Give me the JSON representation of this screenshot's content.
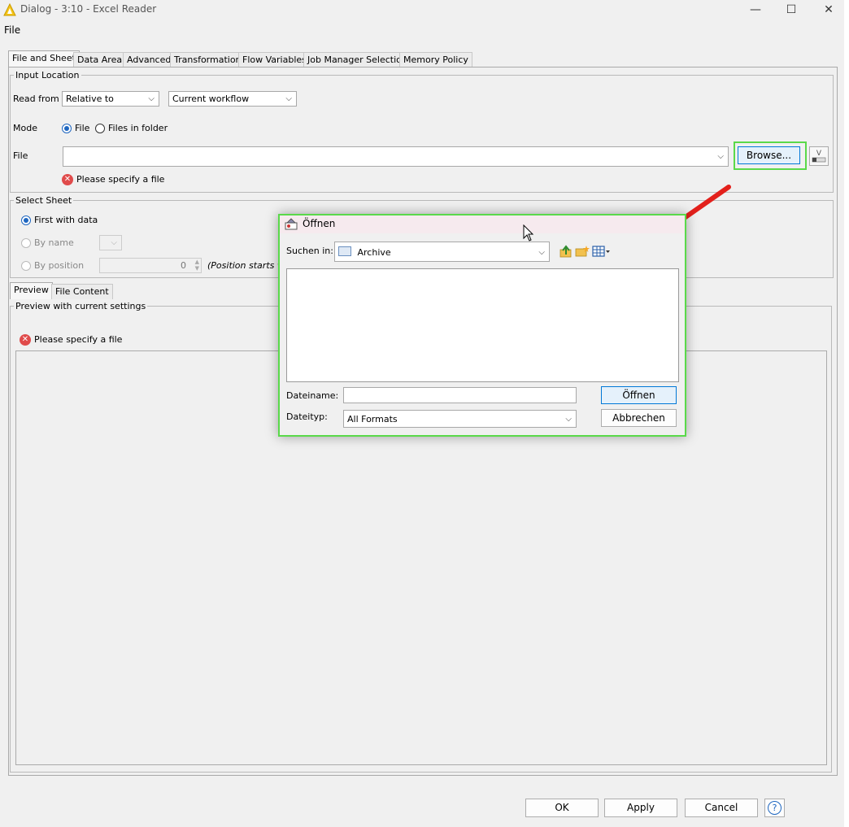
{
  "window": {
    "title": "Dialog - 3:10 - Excel Reader",
    "minimize_glyph": "—",
    "maximize_glyph": "☐",
    "close_glyph": "✕",
    "icon": "knime-triangle-icon"
  },
  "menu": {
    "file": "File"
  },
  "tabs": [
    "File and Sheet",
    "Data Area",
    "Advanced",
    "Transformation",
    "Flow Variables",
    "Job Manager Selection",
    "Memory Policy"
  ],
  "input_location": {
    "legend": "Input Location",
    "read_from_label": "Read from",
    "read_from_value": "Relative to",
    "workflow_value": "Current workflow",
    "mode_label": "Mode",
    "mode_file": "File",
    "mode_folder": "Files in folder",
    "file_label": "File",
    "file_value": "",
    "browse_label": "Browse...",
    "error": "Please specify a file"
  },
  "select_sheet": {
    "legend": "Select Sheet",
    "first_with_data": "First with data",
    "by_name": "By name",
    "by_position": "By position",
    "position_value": "0",
    "position_hint": "(Position starts wi"
  },
  "preview": {
    "tabs": [
      "Preview",
      "File Content"
    ],
    "legend": "Preview with current settings",
    "error": "Please specify a file"
  },
  "footer": {
    "ok": "OK",
    "apply": "Apply",
    "cancel": "Cancel",
    "help_glyph": "?"
  },
  "open_dialog": {
    "title": "Öffnen",
    "look_in_label": "Suchen in:",
    "look_in_value": "Archive",
    "filename_label": "Dateiname:",
    "filename_value": "",
    "filetype_label": "Dateityp:",
    "filetype_value": "All Formats",
    "open_button": "Öffnen",
    "cancel_button": "Abbrechen"
  },
  "colors": {
    "highlight": "#5ad94a",
    "arrow": "#e3201b",
    "error": "#e04b4b",
    "selected": "#1e66c0"
  }
}
